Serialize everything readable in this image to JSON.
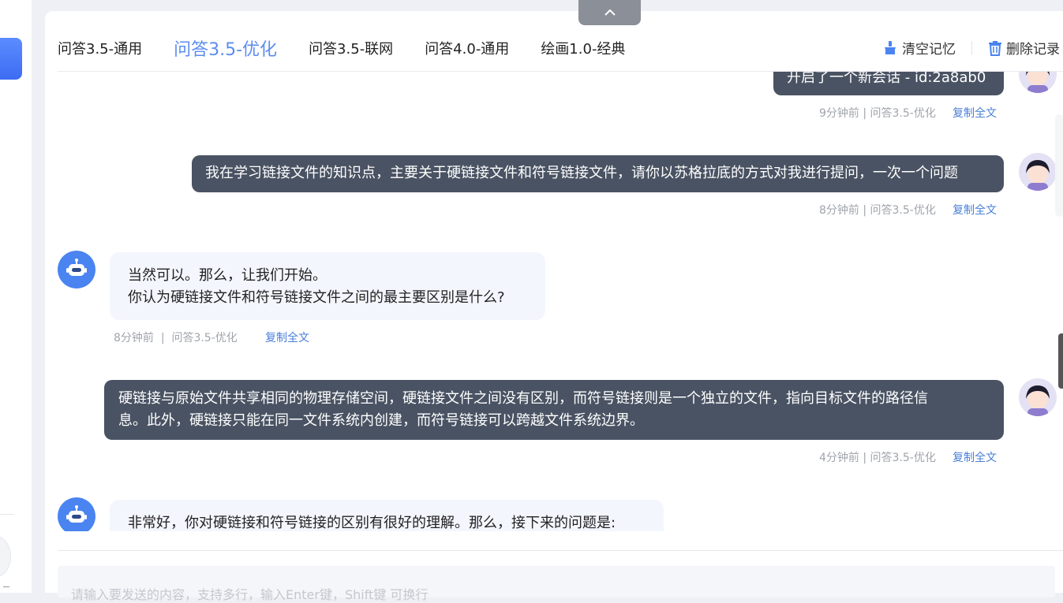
{
  "tabs": [
    {
      "label": "问答3.5-通用",
      "active": false
    },
    {
      "label": "问答3.5-优化",
      "active": true
    },
    {
      "label": "问答3.5-联网",
      "active": false
    },
    {
      "label": "问答4.0-通用",
      "active": false
    },
    {
      "label": "绘画1.0-经典",
      "active": false
    }
  ],
  "actions": {
    "clear_memory": "清空记忆",
    "delete_records": "删除记录"
  },
  "messages": [
    {
      "role": "user",
      "text": "开启了一个新会话 - id:2a8ab0",
      "time": "9分钟前 | 问答3.5-优化",
      "copy": "复制全文"
    },
    {
      "role": "user",
      "text": "我在学习链接文件的知识点，主要关于硬链接文件和符号链接文件，请你以苏格拉底的方式对我进行提问，一次一个问题",
      "time": "8分钟前 | 问答3.5-优化",
      "copy": "复制全文"
    },
    {
      "role": "bot",
      "line1": "当然可以。那么，让我们开始。",
      "line2": "你认为硬链接文件和符号链接文件之间的最主要区别是什么?",
      "time": "8分钟前",
      "model": "问答3.5-优化",
      "copy": "复制全文"
    },
    {
      "role": "user",
      "line1": "硬链接与原始文件共享相同的物理存储空间，硬链接文件之间没有区别，而符号链接则是一个独立的文件，指向目标文件的路径信",
      "line2": "息。此外，硬链接只能在同一文件系统内创建，而符号链接可以跨越文件系统边界。",
      "time": "4分钟前 | 问答3.5-优化",
      "copy": "复制全文"
    },
    {
      "role": "bot",
      "text": "非常好，你对硬链接和符号链接的区别有很好的理解。那么，接下来的问题是:"
    }
  ],
  "input": {
    "placeholder": "请输入要发送的内容，支持多行，输入Enter键，Shift键 可换行"
  },
  "icons": {
    "collapse": "chevron-up-icon",
    "clear": "broom-icon",
    "delete": "trash-icon",
    "bot": "robot-icon",
    "user": "user-avatar"
  },
  "colors": {
    "accent": "#5b8def",
    "user_bubble": "#4a5363",
    "bot_bubble": "#f3f6fd",
    "link": "#4a7fd8"
  }
}
